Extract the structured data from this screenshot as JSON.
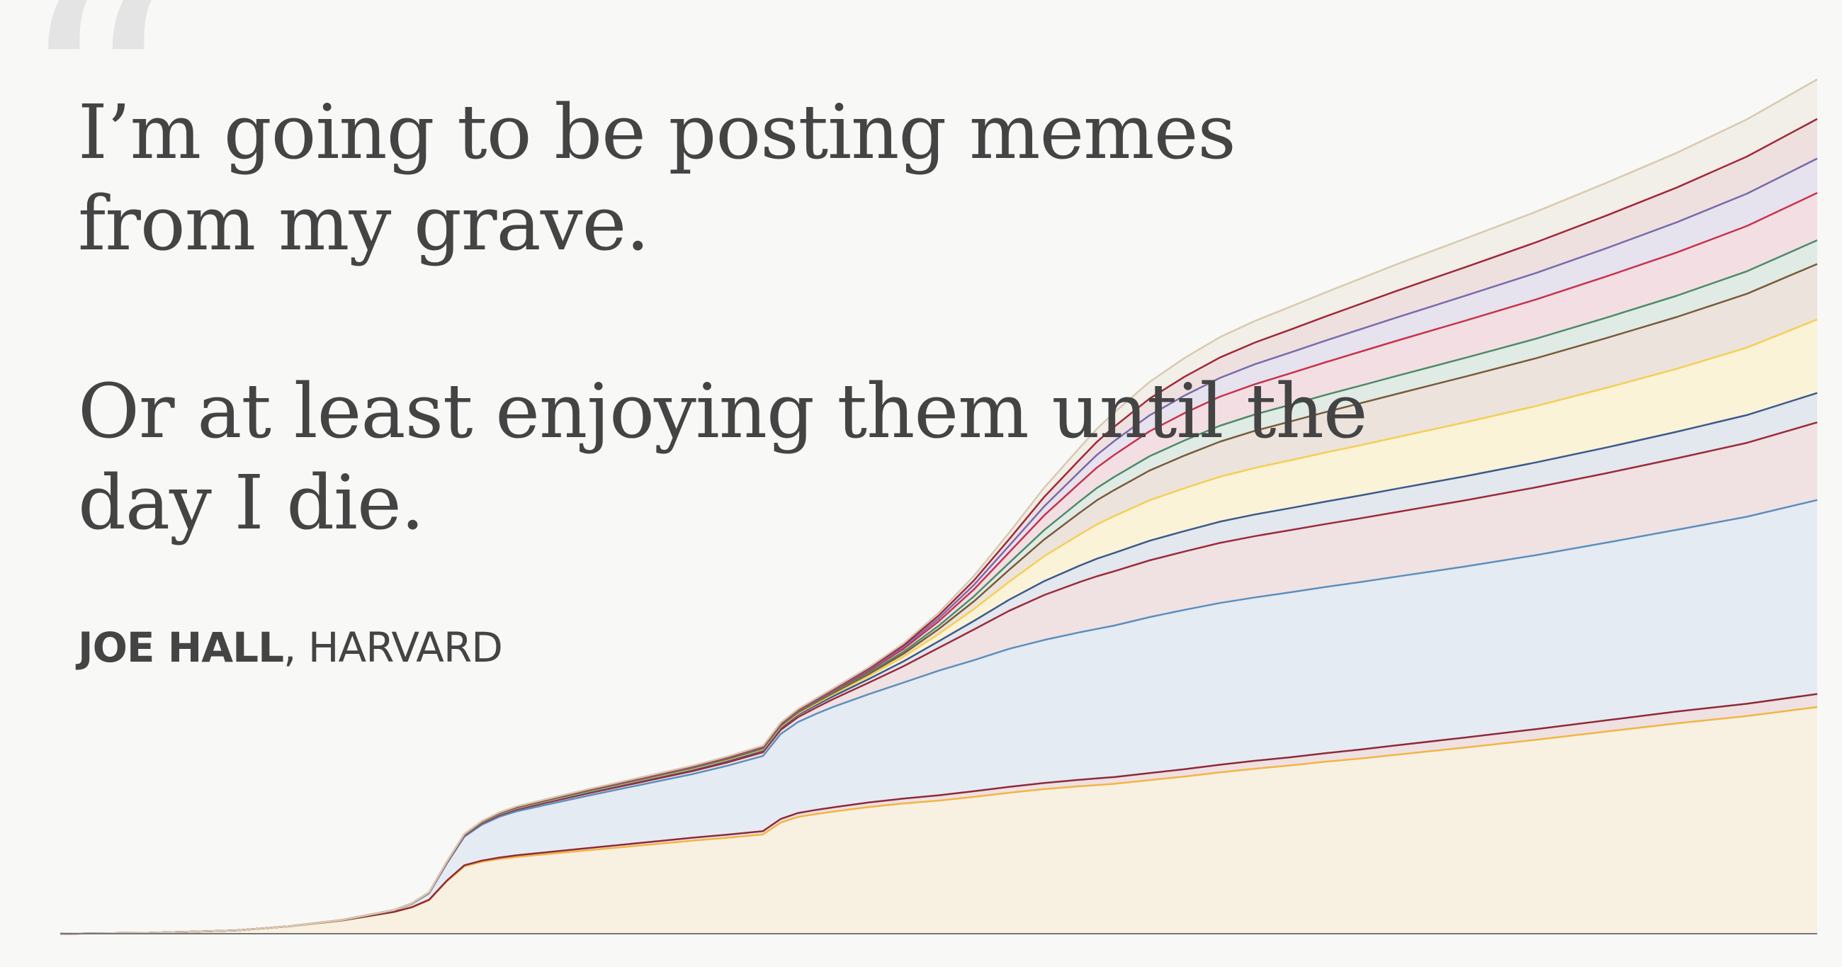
{
  "quote": {
    "mark": "“",
    "line1": "I’m going to be posting memes from my grave.",
    "line2": "Or at least enjoying them until the day I die."
  },
  "attribution": {
    "name": "JOE HALL",
    "separator": ", ",
    "affiliation": "HARVARD"
  },
  "colors": {
    "background": "#f8f8f7",
    "text": "#444444",
    "quote_mark": "#e4e4e4"
  },
  "chart_data": {
    "type": "area",
    "stacked": true,
    "title": "",
    "xlabel": "",
    "ylabel": "",
    "grid": false,
    "legend": "none",
    "x": [
      0,
      0.05,
      0.1,
      0.13,
      0.16,
      0.19,
      0.2,
      0.21,
      0.22,
      0.23,
      0.24,
      0.25,
      0.26,
      0.28,
      0.3,
      0.33,
      0.36,
      0.38,
      0.4,
      0.41,
      0.42,
      0.43,
      0.44,
      0.46,
      0.48,
      0.5,
      0.52,
      0.54,
      0.56,
      0.58,
      0.59,
      0.6,
      0.62,
      0.64,
      0.66,
      0.68,
      0.7,
      0.72,
      0.74,
      0.76,
      0.8,
      0.84,
      0.88,
      0.92,
      0.96,
      1.0
    ],
    "series": [
      {
        "color": "#f2b544",
        "fill": "#f8f1e2",
        "values": [
          0,
          0.2,
          0.8,
          1.8,
          3.2,
          5.3,
          6.4,
          8.2,
          12.8,
          16.5,
          17.6,
          18.3,
          18.8,
          19.6,
          20.4,
          21.6,
          22.8,
          23.5,
          24.3,
          27.2,
          28.6,
          29.3,
          29.9,
          31.0,
          31.9,
          32.6,
          33.5,
          34.5,
          35.4,
          36.1,
          36.4,
          36.7,
          37.6,
          38.5,
          39.5,
          40.4,
          41.2,
          42.1,
          42.9,
          43.8,
          45.6,
          47.5,
          49.5,
          51.5,
          53.3,
          55.5
        ]
      },
      {
        "color": "#8e2a3a",
        "fill": "#efe0e2",
        "values": [
          0,
          0,
          0,
          0,
          0.02,
          0.05,
          0.08,
          0.12,
          0.18,
          0.25,
          0.3,
          0.35,
          0.4,
          0.48,
          0.55,
          0.62,
          0.7,
          0.76,
          0.82,
          0.88,
          0.95,
          1.0,
          1.05,
          1.12,
          1.2,
          1.3,
          1.38,
          1.45,
          1.52,
          1.58,
          1.62,
          1.66,
          1.72,
          1.8,
          1.88,
          1.95,
          2.0,
          2.1,
          2.2,
          2.3,
          2.45,
          2.6,
          2.75,
          2.9,
          3.0,
          3.2
        ]
      },
      {
        "color": "#5b8fbf",
        "fill": "#e5ebf2",
        "values": [
          0,
          0,
          0,
          0,
          0.1,
          0.4,
          0.8,
          1.6,
          4.2,
          7.0,
          8.8,
          10.0,
          10.8,
          11.8,
          12.8,
          14.2,
          15.6,
          16.9,
          18.4,
          20.8,
          22.3,
          23.5,
          24.6,
          26.5,
          28.4,
          30.5,
          32.1,
          33.8,
          35.0,
          36.1,
          36.6,
          37.1,
          38.2,
          39.0,
          39.6,
          40.0,
          40.4,
          40.7,
          41.0,
          41.3,
          41.9,
          42.6,
          43.5,
          44.5,
          45.8,
          47.5
        ]
      },
      {
        "color": "#9c2b3b",
        "fill": "#f0e2e3",
        "values": [
          0,
          0,
          0,
          0,
          0,
          0.02,
          0.04,
          0.08,
          0.15,
          0.25,
          0.32,
          0.38,
          0.42,
          0.5,
          0.56,
          0.64,
          0.72,
          0.8,
          0.9,
          1.0,
          1.2,
          1.5,
          1.9,
          2.8,
          4.0,
          5.6,
          7.5,
          9.3,
          11.0,
          12.3,
          12.9,
          13.3,
          13.9,
          14.3,
          14.7,
          15.0,
          15.2,
          15.4,
          15.6,
          15.8,
          16.2,
          16.6,
          17.0,
          17.5,
          18.1,
          19.0
        ]
      },
      {
        "color": "#3c5a8a",
        "fill": "#e3e7ee",
        "values": [
          0,
          0,
          0,
          0,
          0,
          0.01,
          0.02,
          0.04,
          0.08,
          0.12,
          0.16,
          0.2,
          0.22,
          0.26,
          0.3,
          0.34,
          0.38,
          0.42,
          0.46,
          0.5,
          0.56,
          0.62,
          0.7,
          0.9,
          1.2,
          1.6,
          2.1,
          2.7,
          3.4,
          4.0,
          4.3,
          4.5,
          4.8,
          5.0,
          5.2,
          5.3,
          5.4,
          5.5,
          5.6,
          5.7,
          5.9,
          6.1,
          6.3,
          6.5,
          6.8,
          7.2
        ]
      },
      {
        "color": "#f5cf55",
        "fill": "#fbf3d8",
        "values": [
          0,
          0,
          0,
          0,
          0,
          0.01,
          0.02,
          0.03,
          0.05,
          0.08,
          0.1,
          0.12,
          0.14,
          0.16,
          0.18,
          0.2,
          0.22,
          0.24,
          0.26,
          0.28,
          0.32,
          0.38,
          0.46,
          0.7,
          1.1,
          1.8,
          2.9,
          4.4,
          6.1,
          7.6,
          8.4,
          9.0,
          9.9,
          10.5,
          11.0,
          11.4,
          11.7,
          12.0,
          12.3,
          12.6,
          13.2,
          13.8,
          14.6,
          15.4,
          16.5,
          18.0
        ]
      },
      {
        "color": "#7a5a3a",
        "fill": "#ebe3dc",
        "values": [
          0,
          0,
          0,
          0,
          0,
          0.01,
          0.02,
          0.03,
          0.04,
          0.06,
          0.08,
          0.1,
          0.11,
          0.12,
          0.14,
          0.16,
          0.18,
          0.2,
          0.22,
          0.24,
          0.27,
          0.3,
          0.35,
          0.5,
          0.75,
          1.2,
          1.9,
          2.9,
          4.1,
          5.3,
          5.9,
          6.4,
          7.3,
          8.0,
          8.6,
          9.1,
          9.5,
          9.9,
          10.3,
          10.6,
          11.2,
          11.7,
          12.2,
          12.7,
          13.2,
          13.6
        ]
      },
      {
        "color": "#4e8a6a",
        "fill": "#e0ebe5",
        "values": [
          0,
          0,
          0,
          0,
          0,
          0,
          0.01,
          0.02,
          0.03,
          0.04,
          0.05,
          0.06,
          0.07,
          0.08,
          0.09,
          0.1,
          0.12,
          0.13,
          0.14,
          0.16,
          0.18,
          0.2,
          0.24,
          0.34,
          0.5,
          0.8,
          1.2,
          1.7,
          2.3,
          2.8,
          3.0,
          3.2,
          3.5,
          3.7,
          3.9,
          4.0,
          4.1,
          4.2,
          4.3,
          4.4,
          4.6,
          4.8,
          5.0,
          5.2,
          5.5,
          5.8
        ]
      },
      {
        "color": "#c8324a",
        "fill": "#f3dfe3",
        "values": [
          0,
          0,
          0,
          0,
          0,
          0,
          0.01,
          0.02,
          0.03,
          0.05,
          0.06,
          0.07,
          0.08,
          0.09,
          0.1,
          0.12,
          0.14,
          0.16,
          0.18,
          0.2,
          0.22,
          0.26,
          0.3,
          0.45,
          0.7,
          1.1,
          1.7,
          2.6,
          3.6,
          4.5,
          5.0,
          5.4,
          6.1,
          6.7,
          7.1,
          7.4,
          7.7,
          8.0,
          8.3,
          8.6,
          9.1,
          9.6,
          10.1,
          10.6,
          11.1,
          11.6
        ]
      },
      {
        "color": "#7a6aaa",
        "fill": "#e6e2ee",
        "values": [
          0,
          0,
          0,
          0,
          0,
          0,
          0.01,
          0.01,
          0.02,
          0.03,
          0.04,
          0.05,
          0.06,
          0.07,
          0.08,
          0.09,
          0.1,
          0.11,
          0.12,
          0.13,
          0.15,
          0.17,
          0.2,
          0.3,
          0.45,
          0.7,
          1.1,
          1.6,
          2.2,
          2.8,
          3.1,
          3.4,
          3.9,
          4.3,
          4.6,
          4.9,
          5.1,
          5.3,
          5.5,
          5.7,
          6.1,
          6.5,
          6.9,
          7.4,
          7.9,
          8.4
        ]
      },
      {
        "color": "#a02838",
        "fill": "#efe0e0",
        "values": [
          0,
          0,
          0,
          0,
          0,
          0,
          0,
          0.01,
          0.02,
          0.03,
          0.04,
          0.05,
          0.06,
          0.07,
          0.08,
          0.09,
          0.1,
          0.11,
          0.12,
          0.13,
          0.15,
          0.17,
          0.2,
          0.3,
          0.45,
          0.7,
          1.1,
          1.6,
          2.3,
          2.9,
          3.2,
          3.5,
          4.1,
          4.6,
          5.0,
          5.3,
          5.6,
          5.9,
          6.2,
          6.5,
          7.0,
          7.5,
          8.0,
          8.5,
          9.1,
          9.7
        ]
      },
      {
        "color": "#d8cab0",
        "fill": "#f2eee8",
        "values": [
          0,
          0,
          0,
          0,
          0,
          0,
          0,
          0.01,
          0.02,
          0.03,
          0.04,
          0.05,
          0.06,
          0.07,
          0.08,
          0.09,
          0.1,
          0.11,
          0.12,
          0.13,
          0.15,
          0.17,
          0.2,
          0.3,
          0.45,
          0.7,
          1.1,
          1.6,
          2.3,
          2.9,
          3.2,
          3.5,
          4.1,
          4.6,
          5.0,
          5.3,
          5.6,
          5.9,
          6.2,
          6.5,
          7.0,
          7.5,
          8.0,
          8.5,
          9.1,
          9.7
        ]
      }
    ]
  }
}
